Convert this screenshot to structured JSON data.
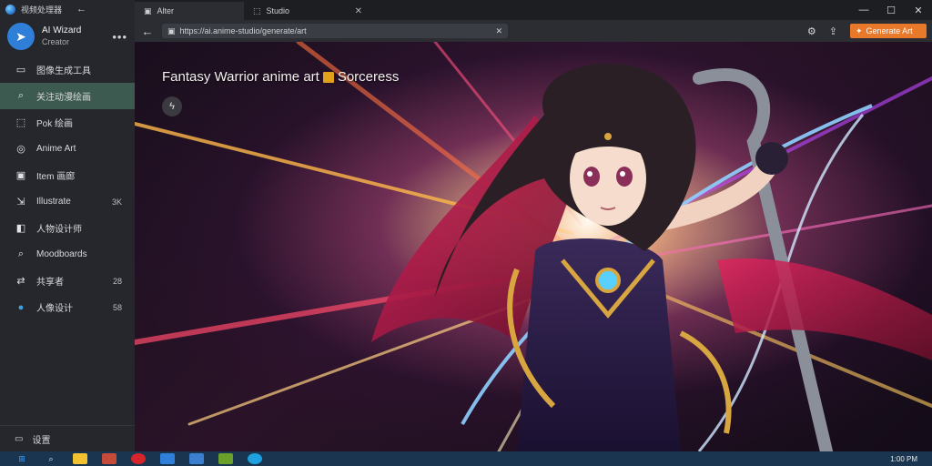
{
  "sidebar": {
    "top_title": "视频处理器",
    "profile": {
      "name": "AI Wizard",
      "subtitle": "Creator",
      "more": "•••"
    },
    "items": [
      {
        "icon": "▭",
        "icon_name": "window-icon",
        "label": "图像生成工具"
      },
      {
        "icon": "⌕",
        "icon_name": "search-icon",
        "label": "关注动漫绘画"
      },
      {
        "icon": "⬚",
        "icon_name": "image-icon",
        "label": "Pok 绘画"
      },
      {
        "icon": "◎",
        "icon_name": "target-icon",
        "label": "Anime Art"
      },
      {
        "icon": "▣",
        "icon_name": "gallery-icon",
        "label": "Item 画廊"
      },
      {
        "icon": "⇲",
        "icon_name": "export-icon",
        "label": "Illustrate",
        "badge": "3K"
      },
      {
        "icon": "◧",
        "icon_name": "document-icon",
        "label": "人物设计师"
      },
      {
        "icon": "⌕",
        "icon_name": "explore-icon",
        "label": "Moodboards"
      },
      {
        "icon": "⇄",
        "icon_name": "share-icon",
        "label": "共享者",
        "badge": "28"
      },
      {
        "icon": "●",
        "icon_name": "globe-icon",
        "label": "人像设计",
        "badge": "58"
      }
    ],
    "bottom_label": "设置"
  },
  "tabs": [
    {
      "label": "Alter",
      "icon": "▣",
      "active": true
    },
    {
      "label": "Studio",
      "icon": "⬚",
      "active": false
    }
  ],
  "address": {
    "url": "https://ai.anime-studio/generate/art",
    "cta_label": "Generate Art"
  },
  "hero": {
    "title_part1": "Fantasy Warrior anime art",
    "title_part2": "Sorceress"
  },
  "taskbar": {
    "clock": "1:00 PM"
  },
  "colors": {
    "accent": "#e8782a",
    "active_nav": "#3c5a4f",
    "taskbar": "#1a3550"
  }
}
